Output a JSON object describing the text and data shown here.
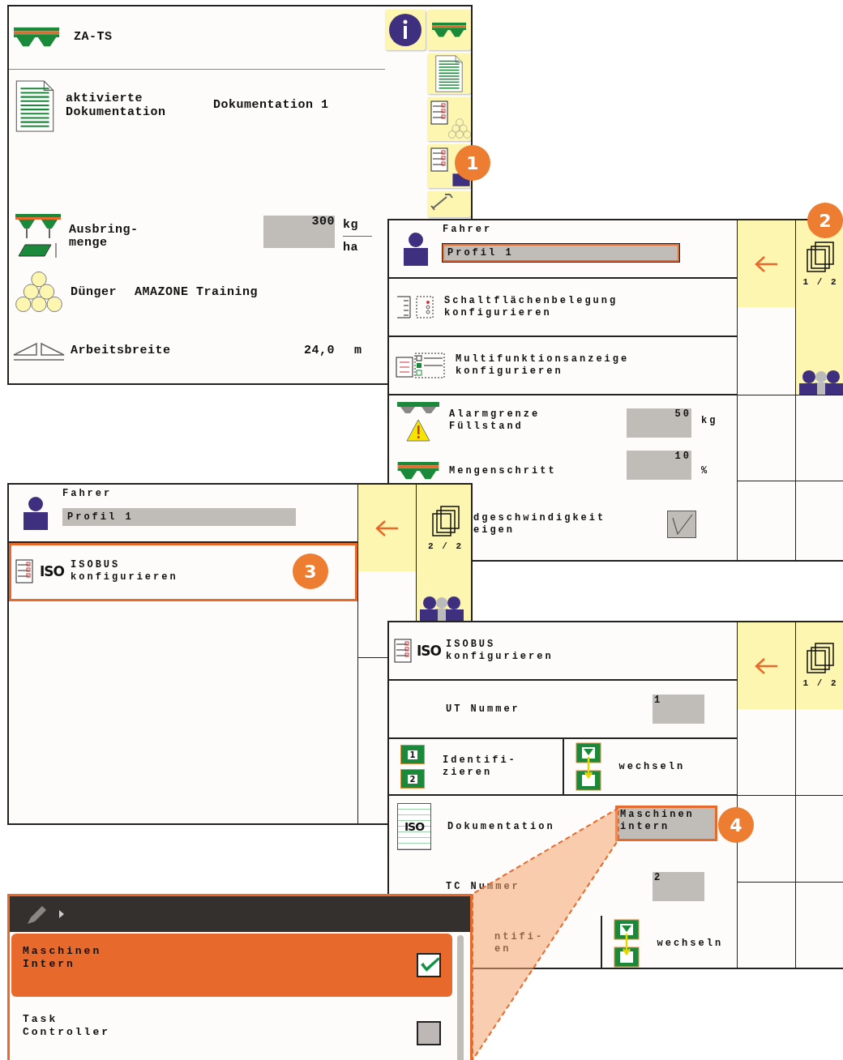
{
  "main_screen": {
    "title": "ZA-TS",
    "rows": [
      {
        "kind": "documentation",
        "label": "aktivierte\nDokumentation",
        "value": "Dokumentation 1"
      },
      {
        "kind": "rate",
        "label": "Ausbring-\nmenge",
        "value": "300",
        "unit": "kg",
        "unit_denominator": "ha"
      },
      {
        "kind": "fertilizer",
        "label": "Dünger",
        "value": "AMAZONE Training"
      },
      {
        "kind": "width",
        "label": "Arbeitsbreite",
        "value": "24,0",
        "unit": "m"
      }
    ]
  },
  "driver_screen_page_1": {
    "label": "Fahrer",
    "profile": {
      "value": "Profil 1",
      "selected": true
    },
    "rows": [
      {
        "kind": "assignment",
        "label": "Schaltflächenbelegung\nkonfigurieren"
      },
      {
        "kind": "display",
        "label": "Multifunktionsanzeige\nkonfigurieren"
      },
      {
        "kind": "alarm",
        "label": "Alarmgrenze\nFüllstand",
        "value": "50",
        "unit": "kg"
      },
      {
        "kind": "step",
        "label": "Mengenschritt",
        "value": "10",
        "unit": "%"
      },
      {
        "kind": "toggle",
        "label": "dgeschwindigkeit\neigen",
        "checked": true
      }
    ],
    "page": "1 / 2"
  },
  "driver_screen_page_2": {
    "label": "Fahrer",
    "profile": {
      "value": "Profil 1",
      "selected": false
    },
    "rows": [
      {
        "kind": "isobus",
        "logo": "ISO",
        "label": "ISOBUS\nkonfigurieren",
        "selected": true
      }
    ],
    "page": "2 / 2"
  },
  "isobus_screen": {
    "logo": "ISO",
    "title": "ISOBUS\nkonfigurieren",
    "rows": [
      {
        "kind": "number",
        "label": "UT Nummer",
        "value": "1",
        "selected": false
      },
      {
        "kind": "pair",
        "chips": [
          "1",
          "2"
        ],
        "label": "Identifi-\nzieren",
        "action": "wechseln",
        "selected": false
      },
      {
        "kind": "documentation",
        "logo": "ISO",
        "label": "Dokumentation",
        "value": "Maschinen\nintern",
        "selected": true
      },
      {
        "kind": "number",
        "label": "TC Nummer",
        "value": "2",
        "selected": false
      },
      {
        "kind": "pair",
        "label": "ntifi-\nen",
        "action": "wechseln",
        "selected": false
      }
    ],
    "page": "1 / 2"
  },
  "dropdown": {
    "options": [
      {
        "label": "Maschinen\nIntern",
        "selected": true,
        "checked": true
      },
      {
        "label": "Task\nController",
        "selected": false,
        "checked": false
      }
    ]
  },
  "callouts": [
    "1",
    "2",
    "3",
    "4"
  ]
}
